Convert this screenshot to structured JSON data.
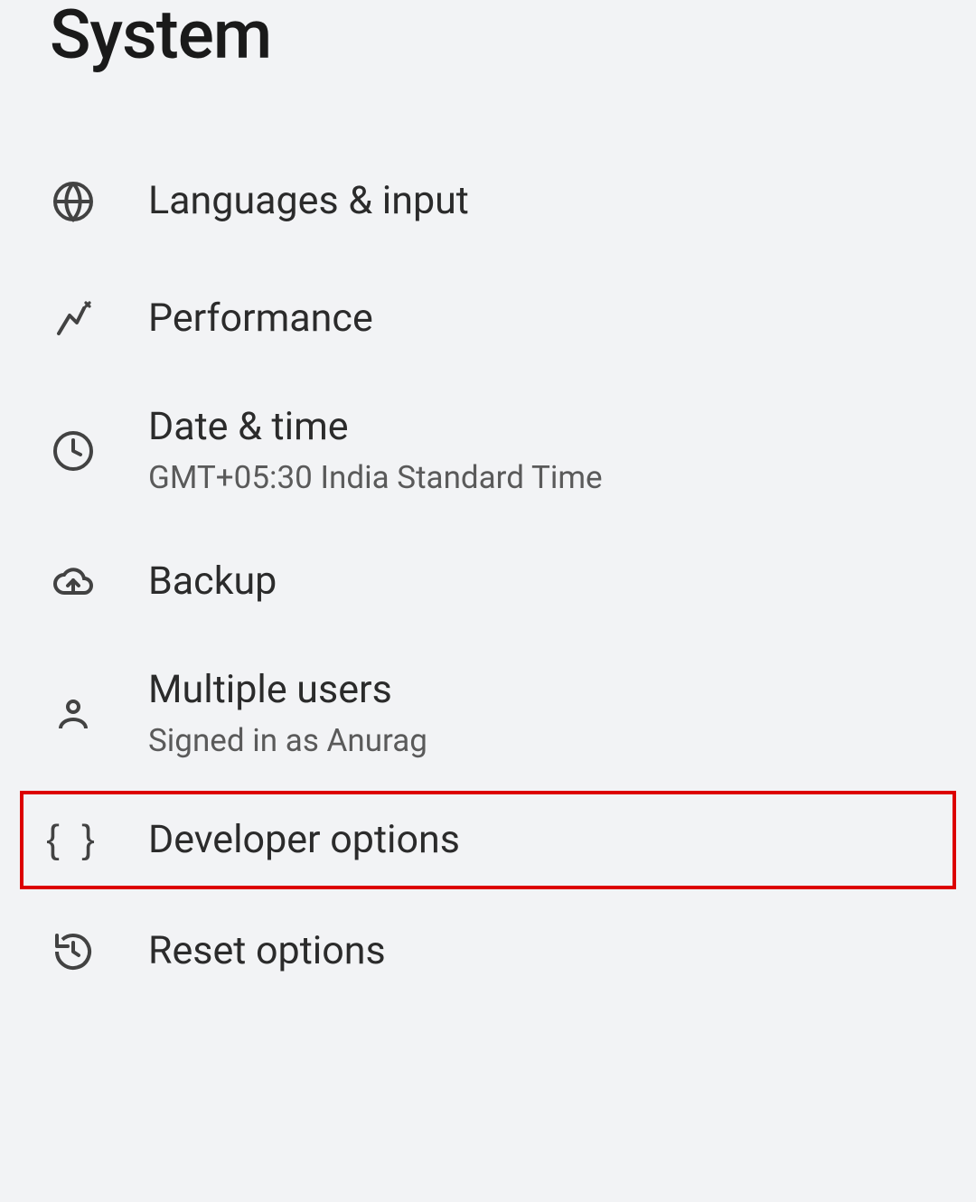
{
  "page": {
    "title": "System"
  },
  "items": [
    {
      "id": "languages",
      "title": "Languages & input",
      "subtitle": null
    },
    {
      "id": "performance",
      "title": "Performance",
      "subtitle": null
    },
    {
      "id": "datetime",
      "title": "Date & time",
      "subtitle": "GMT+05:30 India Standard Time"
    },
    {
      "id": "backup",
      "title": "Backup",
      "subtitle": null
    },
    {
      "id": "multipleusers",
      "title": "Multiple users",
      "subtitle": "Signed in as Anurag"
    },
    {
      "id": "developer",
      "title": "Developer options",
      "subtitle": null
    },
    {
      "id": "reset",
      "title": "Reset options",
      "subtitle": null
    }
  ],
  "highlight": {
    "target": "developer",
    "color": "#dc0000"
  }
}
